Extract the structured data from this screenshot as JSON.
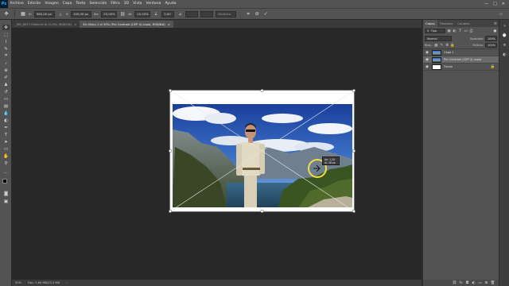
{
  "menubar": {
    "logo": "Ps",
    "items": [
      "Archivo",
      "Edición",
      "Imagen",
      "Capa",
      "Texto",
      "Selección",
      "Filtro",
      "3D",
      "Vista",
      "Ventana",
      "Ayuda"
    ],
    "window_controls": [
      "—",
      "□",
      "✕"
    ]
  },
  "options": {
    "x_label": "X:",
    "x_value": "960,00 px",
    "y_label": "Y:",
    "y_value": "195,00 px",
    "w_label": "An:",
    "w_value": "25,00%",
    "h_label": "Al:",
    "h_value": "25,00%",
    "angle_value": "0,00",
    "interpolation": "Bicúbica"
  },
  "tabs": [
    {
      "label": "_MG_8077 Editar.tif al 21,6% (RGB/16)",
      "close": "×"
    },
    {
      "label": "Sin título-1 al 50% (Pro Contrast (CEP 4) copia, RGB/8#)",
      "close": "×"
    }
  ],
  "status": {
    "zoom": "50%",
    "doc_info": "Doc: 2,64 MB/13,3 MB"
  },
  "transform_hud": {
    "line1": "An: 1,20",
    "line2": "Al: 28 px"
  },
  "layers_panel": {
    "tabs": [
      "Capas",
      "Trazados",
      "Canales"
    ],
    "menu_icon": "≡",
    "filter_kind": "Tipo",
    "blend_mode": "Normal",
    "opacity_label": "Opacidad:",
    "opacity_value": "100%",
    "lock_label": "Bloq.:",
    "fill_label": "Relleno:",
    "fill_value": "100%",
    "layers": [
      {
        "name": "Capa 1",
        "visible": true,
        "selected": false
      },
      {
        "name": "Pro Contrast (CEP 4) copia",
        "visible": true,
        "selected": true
      },
      {
        "name": "Fondo",
        "visible": true,
        "selected": false
      }
    ]
  },
  "colors": {
    "accent": "#31a8ff",
    "ui_panel": "#535353",
    "ui_dark": "#282828",
    "highlight_ring": "#f0e040"
  }
}
